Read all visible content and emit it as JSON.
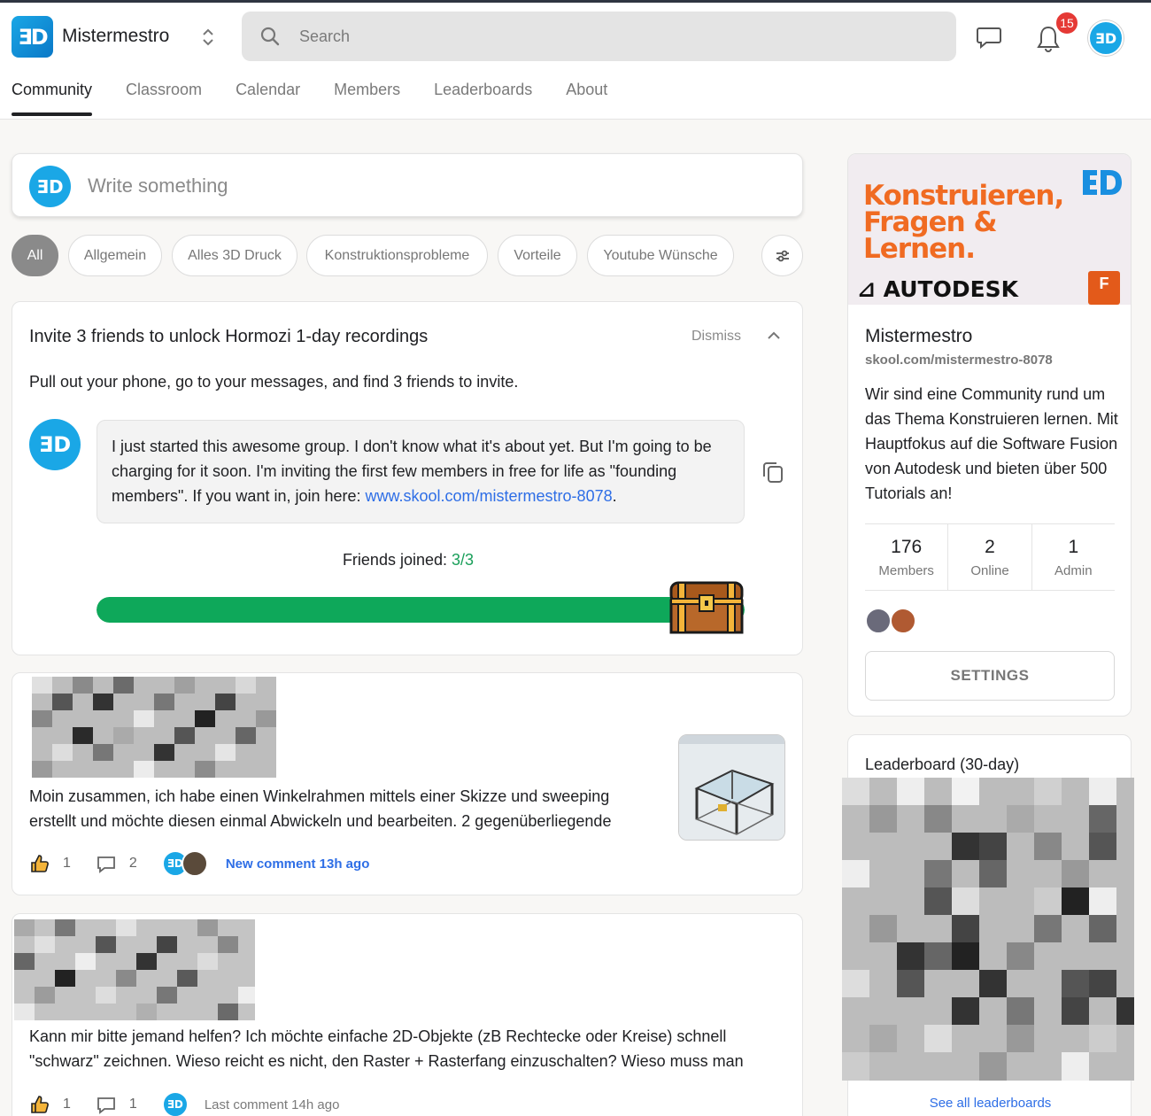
{
  "header": {
    "brand_name": "Mistermestro",
    "search_placeholder": "Search",
    "notification_count": "15"
  },
  "tabs": [
    {
      "label": "Community",
      "active": true
    },
    {
      "label": "Classroom",
      "active": false
    },
    {
      "label": "Calendar",
      "active": false
    },
    {
      "label": "Members",
      "active": false
    },
    {
      "label": "Leaderboards",
      "active": false
    },
    {
      "label": "About",
      "active": false
    }
  ],
  "composer": {
    "placeholder": "Write something"
  },
  "categories": [
    "All",
    "Allgemein",
    "Alles 3D Druck",
    "Konstruktionsprobleme",
    "Vorteile",
    "Youtube Wünsche"
  ],
  "invite": {
    "title": "Invite 3 friends to unlock Hormozi 1-day recordings",
    "dismiss_label": "Dismiss",
    "subtitle": "Pull out your phone, go to your messages, and find 3 friends to invite.",
    "message": "I just started this awesome group. I don't know what it's about yet. But I'm going to be charging for it soon. I'm inviting the first few members in free for life as \"founding members\". If you want in, join here: ",
    "message_link": "www.skool.com/mistermestro-8078",
    "message_end": ".",
    "joined_label": "Friends joined: ",
    "joined_value": "3/3",
    "progress_fraction": 1.0
  },
  "posts": [
    {
      "body": "Moin zusammen, ich habe einen Winkelrahmen mittels einer Skizze und sweeping erstellt und möchte diesen einmal Abwickeln und bearbeiten. 2 gegenüberliegende",
      "likes": "1",
      "comments": "2",
      "activity": "New comment 13h ago"
    },
    {
      "body": "Kann mir bitte jemand helfen? Ich möchte einfache 2D-Objekte (zB Rechtecke oder Kreise) schnell \"schwarz\" zeichnen. Wieso reicht es nicht, den Raster + Rasterfang einzuschalten? Wieso muss man",
      "likes": "1",
      "comments": "1",
      "activity": "Last comment 14h ago"
    }
  ],
  "sidebar": {
    "banner_lines": [
      "Konstruieren,",
      "Fragen &",
      "Lernen."
    ],
    "banner_brand": "AUTODESK",
    "banner_badge": "F",
    "group_name": "Mistermestro",
    "group_url": "skool.com/mistermestro-8078",
    "description": "Wir sind eine Community rund um das Thema Konstruieren lernen. Mit Hauptfokus auf die Software Fusion von Autodesk und bieten über 500 Tutorials an!",
    "stats": [
      {
        "value": "176",
        "label": "Members"
      },
      {
        "value": "2",
        "label": "Online"
      },
      {
        "value": "1",
        "label": "Admin"
      }
    ],
    "settings_label": "SETTINGS"
  },
  "leaderboard": {
    "title": "Leaderboard (30-day)",
    "see_all": "See all leaderboards"
  },
  "colors": {
    "accent_blue": "#2e6ee6",
    "progress_green": "#0ea85a",
    "brand_orange": "#f06b22",
    "badge_red": "#e53935"
  }
}
